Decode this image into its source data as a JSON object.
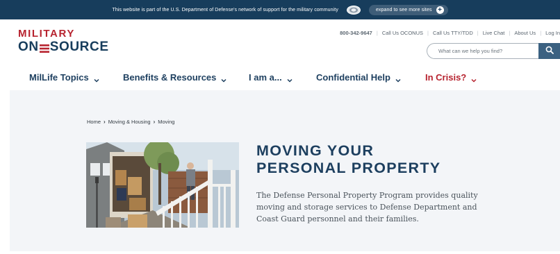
{
  "banner": {
    "text": "This website is part of the U.S. Department of Defense's network of support for the military community",
    "expand_label": "expand to see more sites",
    "expand_icon": "plus-icon"
  },
  "logo": {
    "line1": "MILITARY",
    "line2_part1": "ON",
    "line2_part2": "SOURCE",
    "brand_red": "#b7232f",
    "brand_navy": "#173d5c"
  },
  "utility": {
    "phone": "800-342-9647",
    "links": [
      "Call Us OCONUS",
      "Call Us TTY/TDD",
      "Live Chat",
      "About Us",
      "Log In"
    ]
  },
  "search": {
    "placeholder": "What can we help you find?",
    "value": "",
    "icon": "search-icon"
  },
  "nav": {
    "items": [
      "MilLife Topics",
      "Benefits & Resources",
      "I am a...",
      "Confidential Help",
      "In Crisis?"
    ],
    "crisis_color": "#b7232f"
  },
  "breadcrumb": {
    "items": [
      "Home",
      "Moving & Housing",
      "Moving"
    ]
  },
  "hero": {
    "title_line1": "MOVING YOUR",
    "title_line2": "PERSONAL PROPERTY",
    "description": "The Defense Personal Property Program provides quality moving and storage services to Defense Department and Coast Guard personnel and their families."
  }
}
